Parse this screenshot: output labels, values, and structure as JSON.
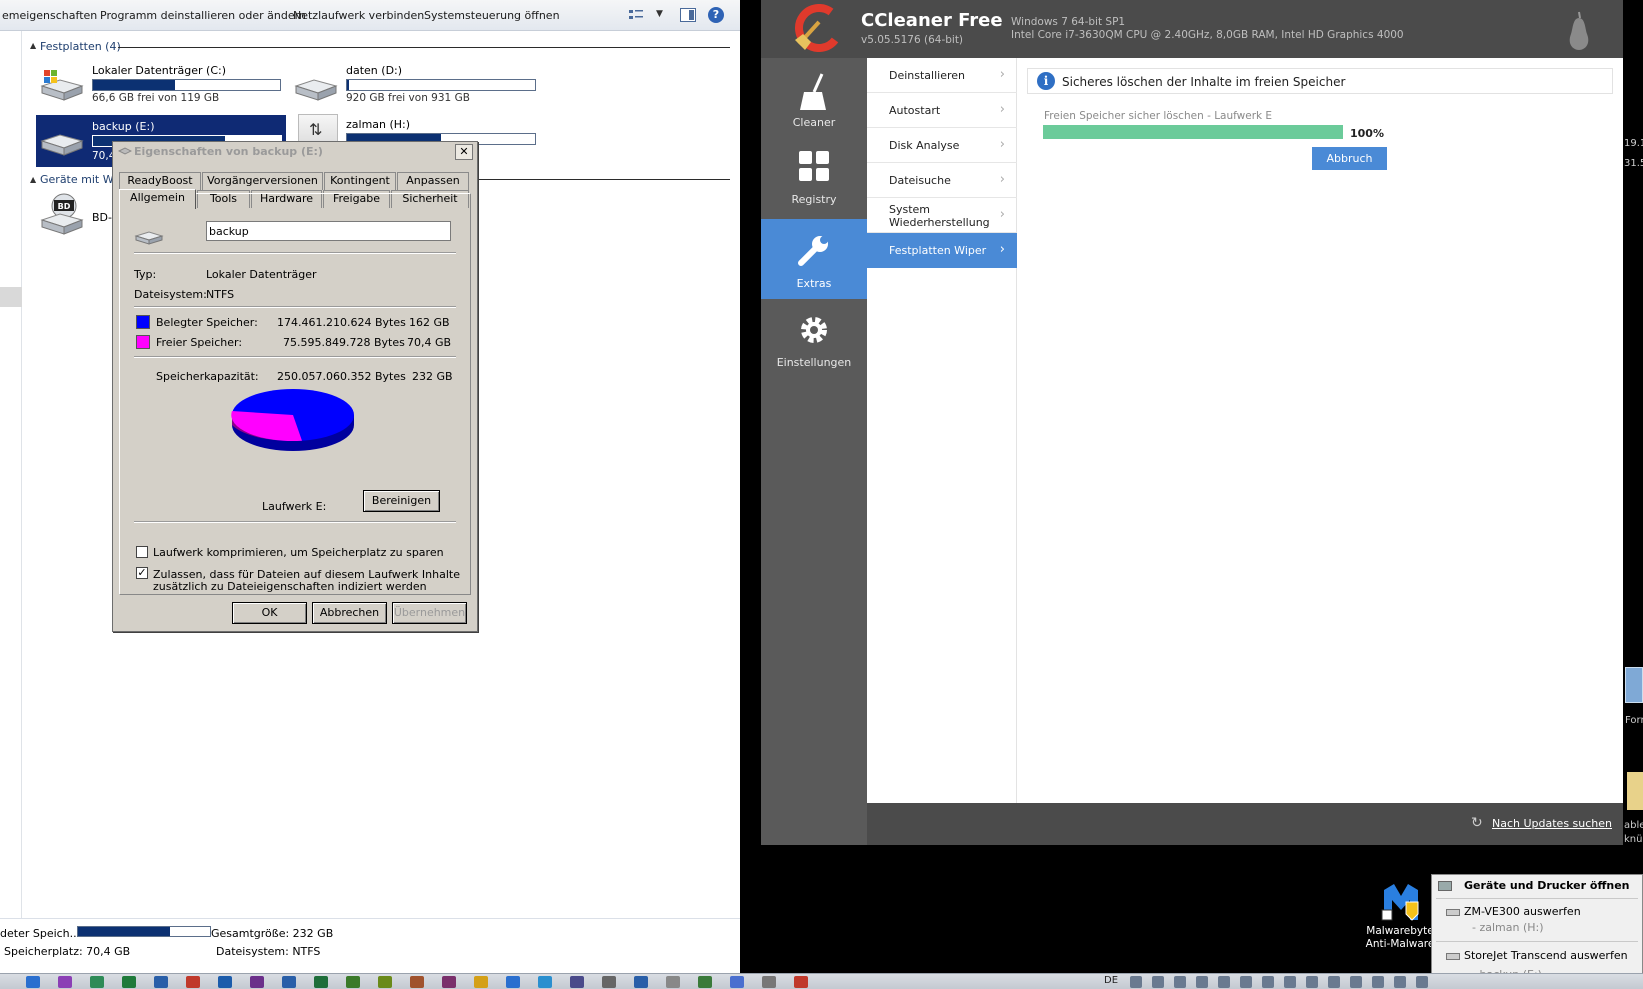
{
  "explorer": {
    "toolbar": {
      "properties": "emeigenschaften",
      "uninstall": "Programm deinstallieren oder ändern",
      "map_drive": "Netzlaufwerk verbinden",
      "control_panel": "Systemsteuerung öffnen"
    },
    "hard_drives_header": "Festplatten (4)",
    "removable_header": "Geräte mit Wec",
    "drives": [
      {
        "name": "Lokaler Datenträger (C:)",
        "free": "66,6 GB frei von 119 GB",
        "used_fraction": 0.44
      },
      {
        "name": "daten (D:)",
        "free": "920 GB frei von 931 GB",
        "used_fraction": 0.01
      },
      {
        "name": "backup (E:)",
        "free": "70,4",
        "used_fraction": 0.7
      },
      {
        "name": "zalman (H:)",
        "free": "",
        "used_fraction": 0.5
      }
    ],
    "bd_label": "BD-I",
    "status": {
      "used_label": "deter Speich...",
      "free_label": "Speicherplatz: 70,4 GB",
      "total_label": "Gesamtgröße: 232 GB",
      "fs_label": "Dateisystem: NTFS",
      "used_fraction": 0.7
    }
  },
  "props": {
    "title": "Eigenschaften von backup (E:)",
    "close": "✕",
    "tabs_top": [
      "ReadyBoost",
      "Vorgängerversionen",
      "Kontingent",
      "Anpassen"
    ],
    "tabs_bottom": [
      "Allgemein",
      "Tools",
      "Hardware",
      "Freigabe",
      "Sicherheit"
    ],
    "drive_label_value": "backup",
    "type_label": "Typ:",
    "type_value": "Lokaler Datenträger",
    "fs_label": "Dateisystem:",
    "fs_value": "NTFS",
    "used_label": "Belegter Speicher:",
    "used_bytes": "174.461.210.624 Bytes",
    "used_gb": "162 GB",
    "free_label": "Freier Speicher:",
    "free_bytes": "75.595.849.728 Bytes",
    "free_gb": "70,4 GB",
    "capacity_label": "Speicherkapazität:",
    "capacity_bytes": "250.057.060.352 Bytes",
    "capacity_gb": "232 GB",
    "drive_caption": "Laufwerk E:",
    "cleanup_button": "Bereinigen",
    "compress_label": "Laufwerk komprimieren, um Speicherplatz zu sparen",
    "index_label_1": "Zulassen, dass für Dateien auf diesem Laufwerk Inhalte",
    "index_label_2": "zusätzlich zu Dateieigenschaften indiziert werden",
    "ok": "OK",
    "cancel": "Abbrechen",
    "apply": "Übernehmen",
    "used_color": "#0000ff",
    "free_color": "#ff00ff"
  },
  "ccleaner": {
    "title": "CCleaner Free",
    "version": "v5.05.5176 (64-bit)",
    "sys_os": "Windows 7 64-bit SP1",
    "sys_hw": "Intel Core i7-3630QM CPU @ 2.40GHz, 8,0GB RAM, Intel HD Graphics 4000",
    "nav": [
      {
        "label": "Cleaner",
        "icon": "broom-icon"
      },
      {
        "label": "Registry",
        "icon": "grid-icon"
      },
      {
        "label": "Extras",
        "icon": "wrench-icon"
      },
      {
        "label": "Einstellungen",
        "icon": "gear-icon"
      }
    ],
    "sub": [
      "Deinstallieren",
      "Autostart",
      "Disk Analyse",
      "Dateisuche",
      "System Wiederherstellung",
      "Festplatten Wiper"
    ],
    "info": "Sicheres löschen der Inhalte im freien Speicher",
    "progress_label": "Freien Speicher sicher löschen - Laufwerk E",
    "progress_pct": "100%",
    "progress_value": 1.0,
    "abort": "Abbruch",
    "update_link": "Nach Updates suchen",
    "accent": "#4a8ad6"
  },
  "desktop": {
    "edge_1": "19.1",
    "edge_2": "31.5",
    "edge_3": "Forr",
    "edge_4": "able",
    "edge_5": "knü",
    "mb_line1": "Malwarebyte",
    "mb_line2": "Anti-Malware"
  },
  "tray_menu": {
    "open_devices": "Geräte und Drucker öffnen",
    "eject_1": "ZM-VE300 auswerfen",
    "eject_1_sub": "- zalman (H:)",
    "eject_2": "StoreJet Transcend auswerfen",
    "eject_2_sub": "- backup (E:)"
  },
  "taskbar": {
    "lang": "DE"
  }
}
